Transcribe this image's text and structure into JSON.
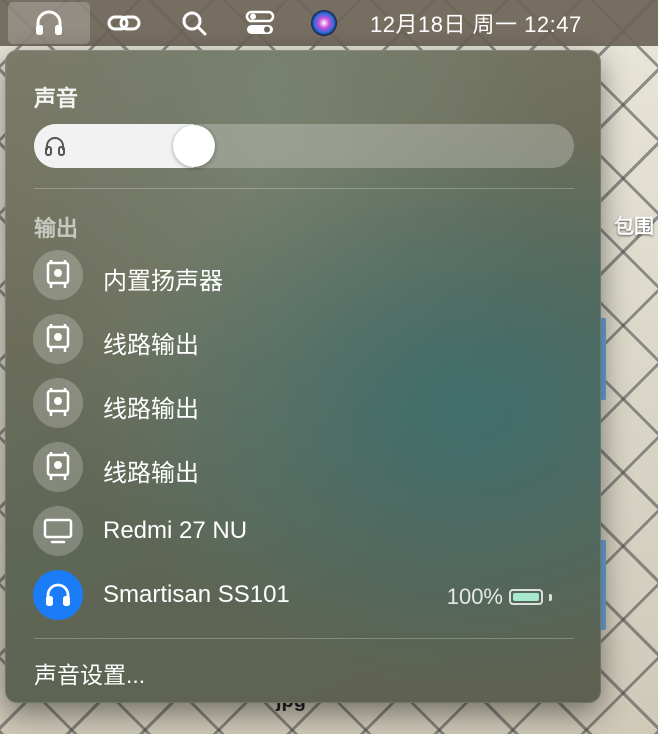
{
  "menubar": {
    "clock": "12月18日 周一  12:47"
  },
  "desktop": {
    "label_right": "包围",
    "file_label": "jpg"
  },
  "sound_panel": {
    "title": "声音",
    "volume": {
      "level_percent": 28
    },
    "output_title": "输出",
    "devices": [
      {
        "label": "内置扬声器",
        "icon": "speaker-icon",
        "selected": true
      },
      {
        "label": "线路输出",
        "icon": "speaker-icon",
        "selected": false
      },
      {
        "label": "线路输出",
        "icon": "speaker-icon",
        "selected": false
      },
      {
        "label": "线路输出",
        "icon": "speaker-icon",
        "selected": false
      },
      {
        "label": "Redmi 27 NU",
        "icon": "display-icon",
        "selected": false
      },
      {
        "label": "Smartisan SS101",
        "icon": "headphones-icon",
        "selected": false,
        "battery": "100%"
      }
    ],
    "settings_label": "声音设置..."
  },
  "colors": {
    "accent": "#1a7cf6",
    "battery": "#a7e8ce"
  }
}
